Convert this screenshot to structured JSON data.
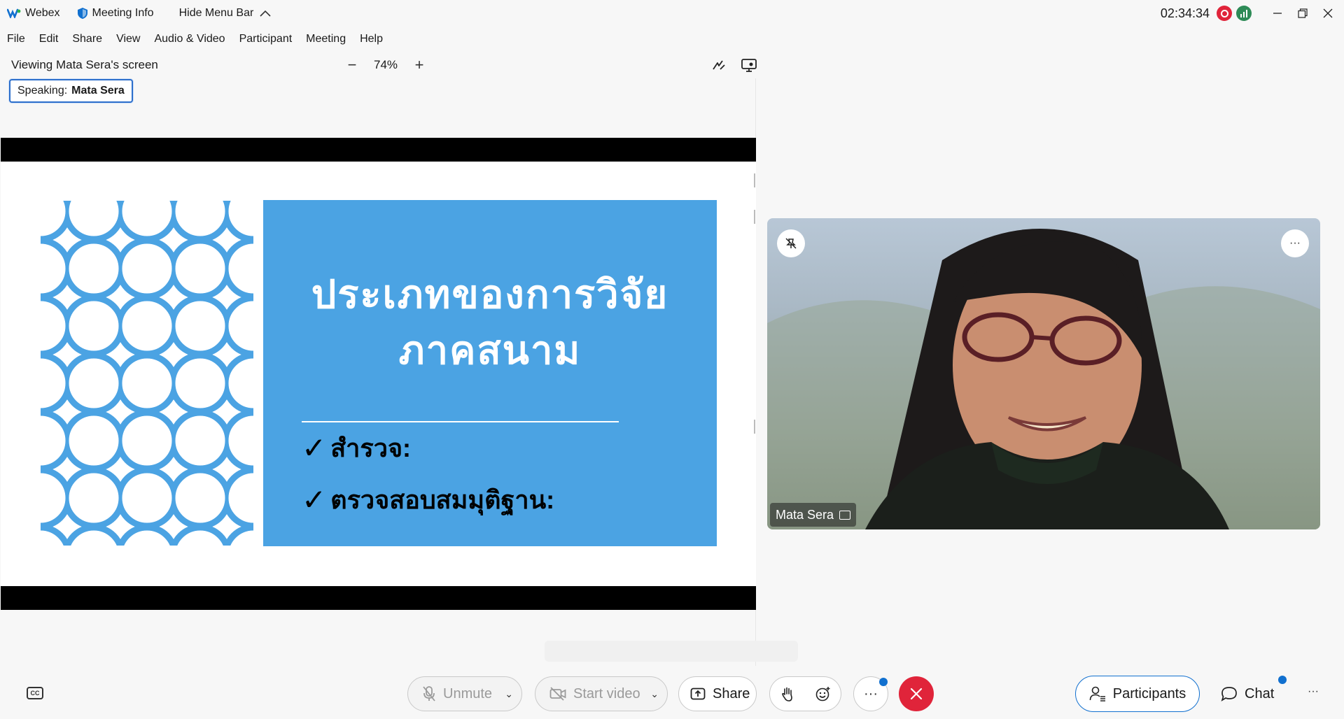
{
  "titlebar": {
    "app_name": "Webex",
    "meeting_info": "Meeting Info",
    "hide_menu_bar": "Hide Menu Bar",
    "clock": "02:34:34"
  },
  "menu": [
    "File",
    "Edit",
    "Share",
    "View",
    "Audio & Video",
    "Participant",
    "Meeting",
    "Help"
  ],
  "share": {
    "title": "Viewing Mata Sera's screen",
    "zoom": "74%",
    "speaking_label": "Speaking:",
    "speaking_name": "Mata Sera"
  },
  "slide": {
    "title_line1": "ประเภทของการวิจัย",
    "title_line2": "ภาคสนาม",
    "bullets": [
      "สำรวจ:",
      "ตรวจสอบสมมุติฐาน:"
    ],
    "check_glyph": "✓"
  },
  "video": {
    "name": "Mata Sera",
    "more": "···"
  },
  "toolbar": {
    "unmute": "Unmute",
    "start_video": "Start video",
    "share": "Share",
    "more": "···",
    "participants": "Participants",
    "chat": "Chat",
    "overflow": "···",
    "cc": "CC"
  },
  "colors": {
    "accent": "#1170cf",
    "end_call": "#e0243a",
    "slide_blue": "#4ba3e3",
    "recording": "#e0243a",
    "network": "#2e8b57"
  },
  "icons": [
    "webex-logo-icon",
    "shield-icon",
    "chevron-up-icon",
    "minimize-icon",
    "restore-icon",
    "close-icon",
    "annotate-icon",
    "monitor-icon",
    "unpin-icon",
    "mic-muted-icon",
    "camera-off-icon",
    "share-screen-icon",
    "raise-hand-icon",
    "reactions-icon",
    "end-call-icon",
    "participants-icon",
    "chat-icon",
    "closed-caption-icon"
  ]
}
